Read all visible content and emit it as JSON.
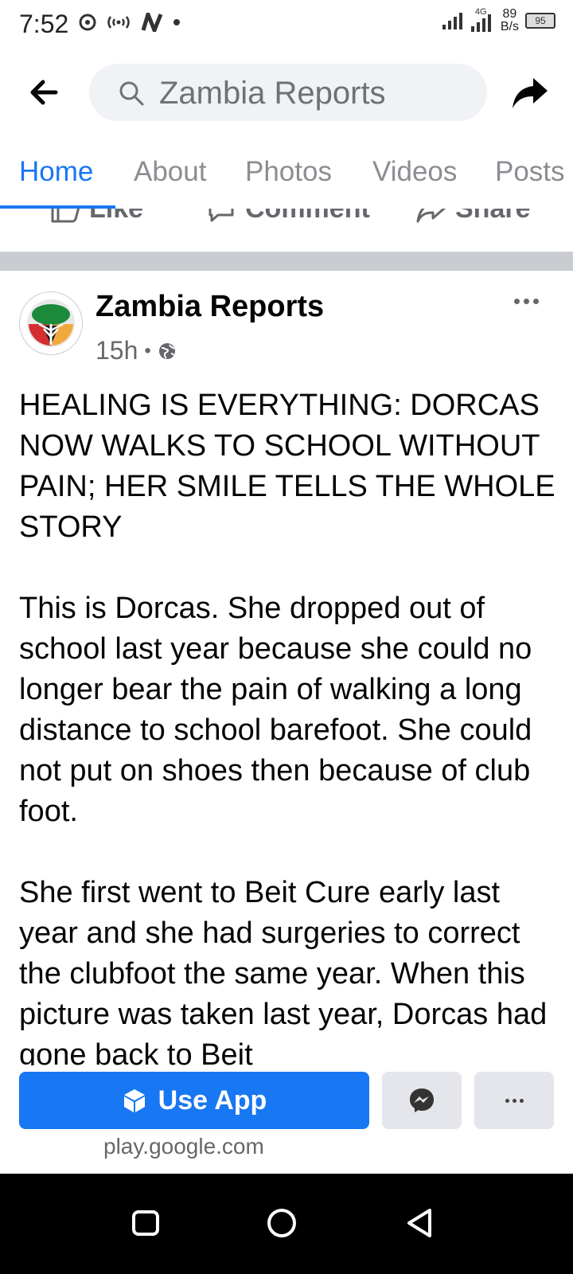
{
  "status_bar": {
    "time": "7:52",
    "net_speed_value": "89",
    "net_speed_unit": "B/s",
    "network_type": "4G",
    "battery": "95"
  },
  "header": {
    "search_text": "Zambia Reports"
  },
  "tabs": [
    {
      "label": "Home",
      "active": true
    },
    {
      "label": "About"
    },
    {
      "label": "Photos"
    },
    {
      "label": "Videos"
    },
    {
      "label": "Posts"
    }
  ],
  "actions": {
    "like": "Like",
    "comment": "Comment",
    "share": "Share"
  },
  "post": {
    "author": "Zambia Reports",
    "time": "15h",
    "paragraphs": [
      "HEALING IS EVERYTHING: DORCAS NOW WALKS TO SCHOOL WITHOUT PAIN; HER SMILE TELLS THE WHOLE STORY",
      "This is Dorcas. She dropped out of school last year because she could no longer bear the pain of walking a long distance to school barefoot. She could not put on shoes then because of club foot.",
      "She first went to Beit Cure early last year and she had surgeries to correct the clubfoot the same year. When this picture was taken last year, Dorcas had gone back to Beit"
    ]
  },
  "bottom_bar": {
    "use_app_label": "Use App",
    "store_url": "play.google.com"
  },
  "colors": {
    "accent": "#1877f2",
    "secondary_text": "#65676b",
    "divider": "#c9ccd1"
  }
}
